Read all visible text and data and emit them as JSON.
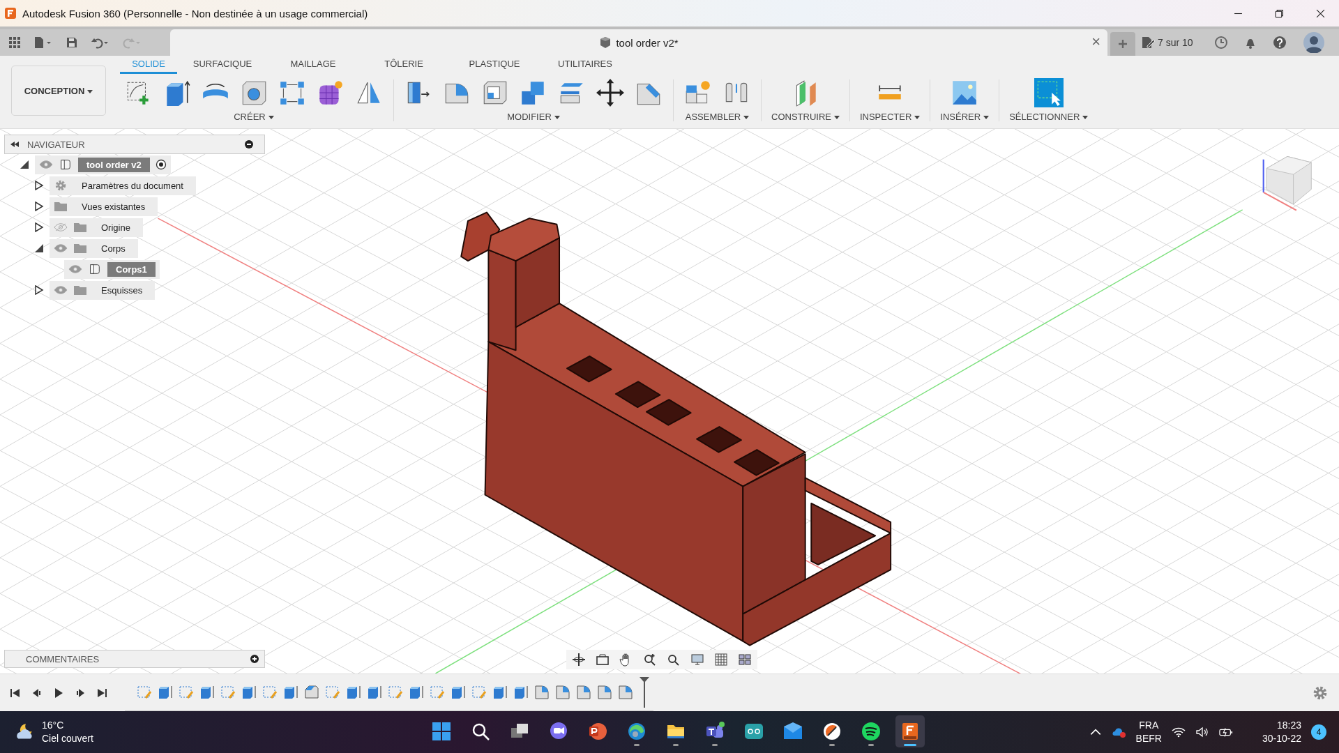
{
  "window": {
    "title": "Autodesk Fusion 360 (Personnelle - Non destinée à un usage commercial)"
  },
  "document_tab": {
    "title": "tool order v2*",
    "close": "×"
  },
  "quota": "7 sur 10",
  "workspace": "CONCEPTION",
  "tabs": [
    {
      "label": "SOLIDE",
      "selected": true
    },
    {
      "label": "SURFACIQUE",
      "selected": false
    },
    {
      "label": "MAILLAGE",
      "selected": false
    },
    {
      "label": "TÔLERIE",
      "selected": false
    },
    {
      "label": "PLASTIQUE",
      "selected": false
    },
    {
      "label": "UTILITAIRES",
      "selected": false
    }
  ],
  "tool_groups": [
    {
      "label": "CRÉER"
    },
    {
      "label": "MODIFIER"
    },
    {
      "label": "ASSEMBLER"
    },
    {
      "label": "CONSTRUIRE"
    },
    {
      "label": "INSPECTER"
    },
    {
      "label": "INSÉRER"
    },
    {
      "label": "SÉLECTIONNER"
    }
  ],
  "navigator": {
    "title": "NAVIGATEUR",
    "items": [
      {
        "label": "tool order v2",
        "kind": "component",
        "visible": true,
        "expanded": true,
        "selected": true,
        "active": true,
        "children": [
          {
            "label": "Paramètres du document",
            "kind": "settings",
            "expanded": false,
            "selected": false
          },
          {
            "label": "Vues existantes",
            "kind": "folder",
            "expanded": false,
            "selected": false
          },
          {
            "label": "Origine",
            "kind": "folder",
            "visible": false,
            "expanded": false,
            "selected": false
          },
          {
            "label": "Corps",
            "kind": "folder",
            "visible": true,
            "expanded": true,
            "selected": false,
            "children": [
              {
                "label": "Corps1",
                "kind": "body",
                "visible": true,
                "selected": true
              }
            ]
          },
          {
            "label": "Esquisses",
            "kind": "folder",
            "visible": true,
            "expanded": false,
            "selected": false
          }
        ]
      }
    ]
  },
  "comments": {
    "title": "COMMENTAIRES"
  },
  "timeline": [
    {
      "kind": "sketch"
    },
    {
      "kind": "extrude"
    },
    {
      "kind": "sketch"
    },
    {
      "kind": "extrude"
    },
    {
      "kind": "sketch"
    },
    {
      "kind": "extrude"
    },
    {
      "kind": "sketch"
    },
    {
      "kind": "extrude"
    },
    {
      "kind": "chamfer"
    },
    {
      "kind": "sketch"
    },
    {
      "kind": "extrude"
    },
    {
      "kind": "extrude"
    },
    {
      "kind": "sketch"
    },
    {
      "kind": "extrude"
    },
    {
      "kind": "sketch"
    },
    {
      "kind": "extrude"
    },
    {
      "kind": "sketch"
    },
    {
      "kind": "extrude"
    },
    {
      "kind": "extrude"
    },
    {
      "kind": "fillet"
    },
    {
      "kind": "fillet"
    },
    {
      "kind": "fillet"
    },
    {
      "kind": "fillet"
    },
    {
      "kind": "fillet"
    }
  ],
  "taskbar": {
    "weather": {
      "temperature": "16°C",
      "condition": "Ciel couvert"
    },
    "apps": [
      {
        "kind": "start",
        "running": false,
        "active": false
      },
      {
        "kind": "search",
        "running": false,
        "active": false
      },
      {
        "kind": "taskview",
        "running": false,
        "active": false
      },
      {
        "kind": "chat",
        "running": false,
        "active": false
      },
      {
        "kind": "powerpoint",
        "running": false,
        "active": false
      },
      {
        "kind": "edge",
        "running": true,
        "active": false
      },
      {
        "kind": "explorer",
        "running": true,
        "active": false
      },
      {
        "kind": "teams",
        "running": true,
        "active": false
      },
      {
        "kind": "arduino",
        "running": false,
        "active": false
      },
      {
        "kind": "mail",
        "running": false,
        "active": false
      },
      {
        "kind": "orange",
        "running": true,
        "active": false
      },
      {
        "kind": "spotify",
        "running": true,
        "active": false
      },
      {
        "kind": "fusion",
        "running": true,
        "active": true
      }
    ],
    "language": "FRA",
    "layout": "BEFR",
    "time": "18:23",
    "date": "30-10-22",
    "notifications": "4"
  }
}
